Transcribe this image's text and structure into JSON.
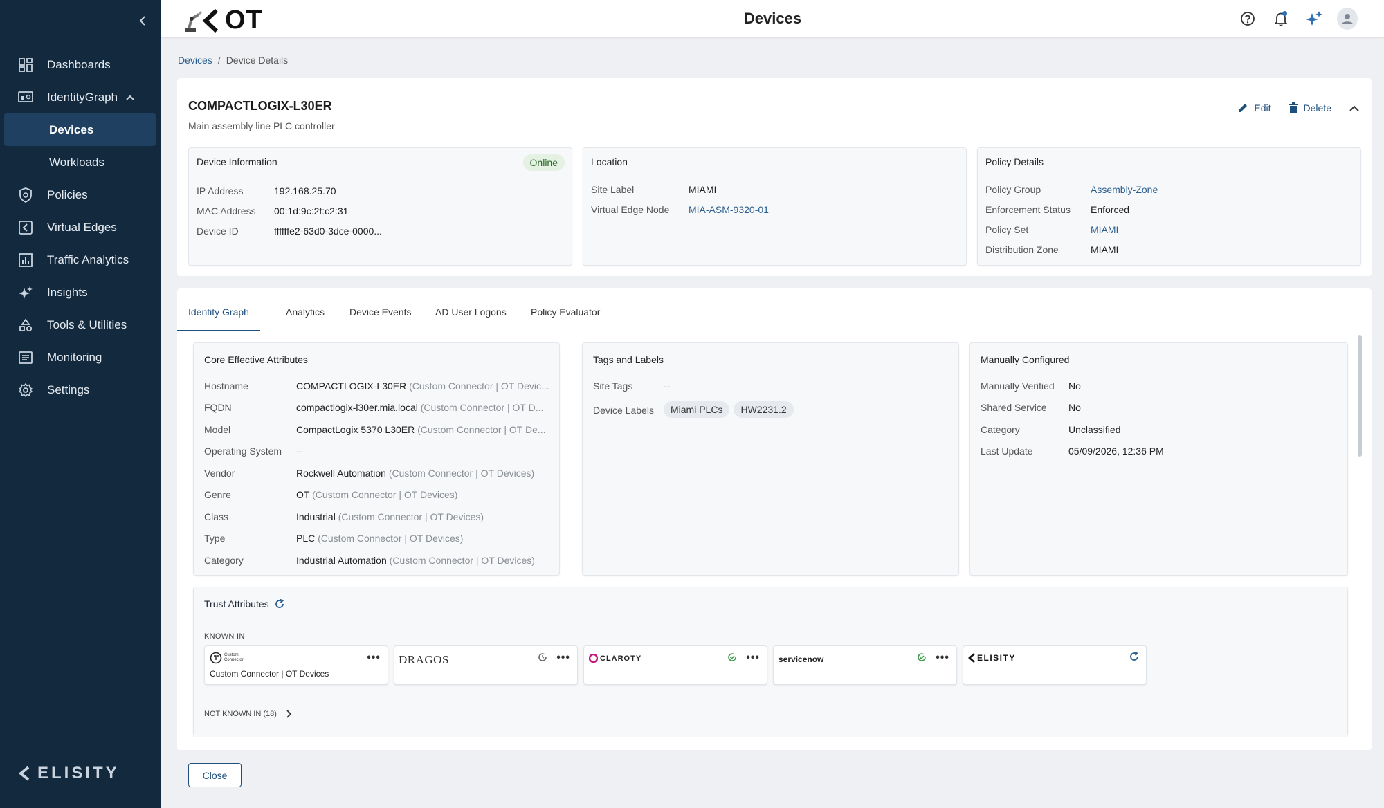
{
  "app": {
    "logo_text": "OT",
    "page_title": "Devices",
    "brand": "ELISITY"
  },
  "sidebar": {
    "items": [
      {
        "label": "Dashboards",
        "icon": "dashboard-icon"
      },
      {
        "label": "IdentityGraph",
        "icon": "identity-graph-icon",
        "expanded": true
      },
      {
        "label": "Devices",
        "sub": true,
        "active": true
      },
      {
        "label": "Workloads",
        "sub": true
      },
      {
        "label": "Policies",
        "icon": "shield-icon"
      },
      {
        "label": "Virtual Edges",
        "icon": "virtual-edge-icon"
      },
      {
        "label": "Traffic Analytics",
        "icon": "bar-chart-icon"
      },
      {
        "label": "Insights",
        "icon": "sparkle-icon"
      },
      {
        "label": "Tools & Utilities",
        "icon": "tools-icon"
      },
      {
        "label": "Monitoring",
        "icon": "monitor-icon"
      },
      {
        "label": "Settings",
        "icon": "gear-icon"
      }
    ]
  },
  "breadcrumb": {
    "root": "Devices",
    "sep": "/",
    "current": "Device Details"
  },
  "device": {
    "name": "COMPACTLOGIX-L30ER",
    "description": "Main assembly line PLC controller",
    "edit_label": "Edit",
    "delete_label": "Delete"
  },
  "device_info": {
    "title": "Device Information",
    "status": "Online",
    "rows": [
      {
        "k": "IP Address",
        "v": "192.168.25.70"
      },
      {
        "k": "MAC Address",
        "v": "00:1d:9c:2f:c2:31"
      },
      {
        "k": "Device ID",
        "v": "ffffffe2-63d0-3dce-0000..."
      }
    ]
  },
  "location": {
    "title": "Location",
    "rows": [
      {
        "k": "Site Label",
        "v": "MIAMI"
      },
      {
        "k": "Virtual Edge Node",
        "v": "MIA-ASM-9320-01"
      }
    ]
  },
  "policy": {
    "title": "Policy Details",
    "rows": [
      {
        "k": "Policy Group",
        "v": "Assembly-Zone"
      },
      {
        "k": "Enforcement Status",
        "v": "Enforced"
      },
      {
        "k": "Policy Set",
        "v": "MIAMI"
      },
      {
        "k": "Distribution Zone",
        "v": "MIAMI"
      }
    ]
  },
  "tabs": [
    "Identity Graph",
    "Analytics",
    "Device Events",
    "AD User Logons",
    "Policy Evaluator"
  ],
  "core_attributes": {
    "title": "Core Effective Attributes",
    "rows": [
      {
        "k": "Hostname",
        "v": "COMPACTLOGIX-L30ER",
        "src": "(Custom Connector | OT Devic..."
      },
      {
        "k": "FQDN",
        "v": "compactlogix-l30er.mia.local",
        "src": "(Custom Connector | OT D..."
      },
      {
        "k": "Model",
        "v": "CompactLogix 5370 L30ER",
        "src": "(Custom Connector | OT De..."
      },
      {
        "k": "Operating System",
        "v": "--",
        "src": ""
      },
      {
        "k": "Vendor",
        "v": "Rockwell Automation",
        "src": "(Custom Connector | OT Devices)"
      },
      {
        "k": "Genre",
        "v": "OT",
        "src": "(Custom Connector | OT Devices)"
      },
      {
        "k": "Class",
        "v": "Industrial",
        "src": "(Custom Connector | OT Devices)"
      },
      {
        "k": "Type",
        "v": "PLC",
        "src": "(Custom Connector | OT Devices)"
      },
      {
        "k": "Category",
        "v": "Industrial Automation",
        "src": "(Custom Connector | OT Devices)"
      }
    ]
  },
  "tags": {
    "title": "Tags and Labels",
    "site_tags_label": "Site Tags",
    "site_tags_value": "--",
    "device_labels_label": "Device Labels",
    "device_labels": [
      "Miami PLCs",
      "HW2231.2"
    ]
  },
  "manual": {
    "title": "Manually Configured",
    "rows": [
      {
        "k": "Manually Verified",
        "v": "No"
      },
      {
        "k": "Shared Service",
        "v": "No"
      },
      {
        "k": "Category",
        "v": "Unclassified"
      },
      {
        "k": "Last Update",
        "v": "05/09/2026, 12:36 PM"
      }
    ]
  },
  "trust": {
    "title": "Trust Attributes",
    "known_in": "KNOWN IN",
    "not_known_in": "NOT KNOWN IN (18)",
    "connectors": [
      {
        "name": "Custom Connector | OT Devices",
        "logo_text": "Custom Connector"
      },
      {
        "name": "DRAGOS",
        "logo_text": "DRAGOS"
      },
      {
        "name": "CLAROTY",
        "logo_text": "CLAROTY"
      },
      {
        "name": "servicenow",
        "logo_text": "servicenow"
      },
      {
        "name": "ELISITY",
        "logo_text": "ELISITY"
      }
    ]
  },
  "footer": {
    "close_label": "Close"
  },
  "colors": {
    "sidebar_bg": "#13293d",
    "accent": "#1f4f7e",
    "online_bg": "#e4f1e3",
    "online_fg": "#2e6b2b",
    "link": "#2c5f8f"
  }
}
